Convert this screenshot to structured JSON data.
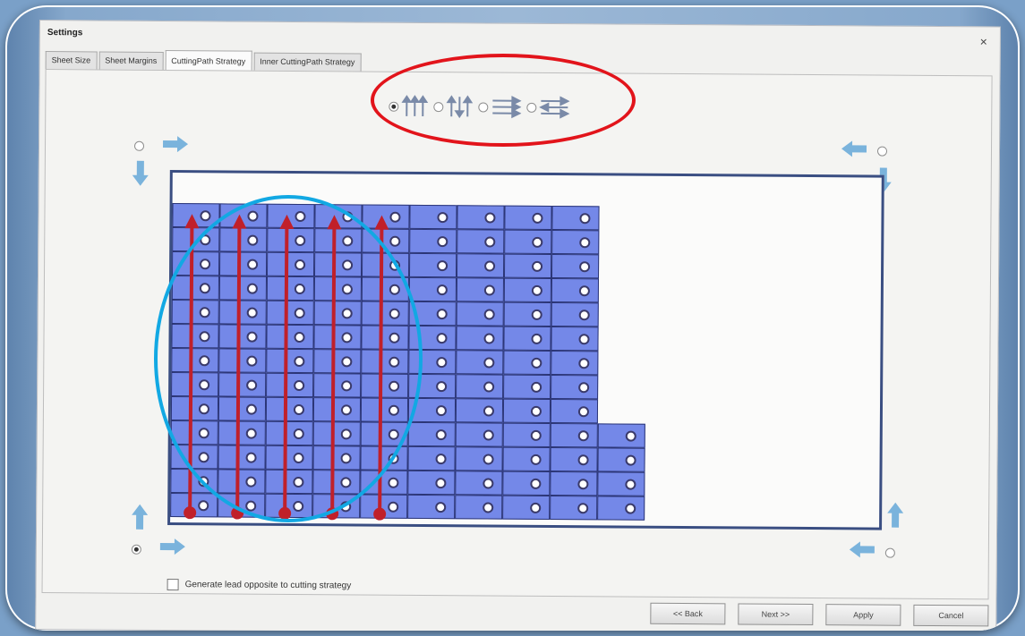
{
  "window": {
    "title": "Settings",
    "close_glyph": "×"
  },
  "tabs": [
    {
      "label": "Sheet Size",
      "active": false
    },
    {
      "label": "Sheet Margins",
      "active": false
    },
    {
      "label": "CuttingPath Strategy",
      "active": true
    },
    {
      "label": "Inner CuttingPath Strategy",
      "active": false
    }
  ],
  "strategy_options": [
    {
      "icon": "vertical-up-arrows-icon",
      "selected": true
    },
    {
      "icon": "vertical-alternating-arrows-icon",
      "selected": false
    },
    {
      "icon": "horizontal-right-arrows-icon",
      "selected": false
    },
    {
      "icon": "horizontal-alternating-arrows-icon",
      "selected": false
    }
  ],
  "start_corners": [
    {
      "corner": "top-left",
      "selected": false
    },
    {
      "corner": "top-right",
      "selected": false
    },
    {
      "corner": "bottom-left",
      "selected": true
    },
    {
      "corner": "bottom-right",
      "selected": false
    }
  ],
  "parts_grid": {
    "column_heights": [
      13,
      13,
      13,
      13,
      13,
      13,
      13,
      13,
      13,
      4
    ]
  },
  "cutting_path_arrows": {
    "count": 5,
    "direction": "up"
  },
  "options": {
    "generate_lead_label": "Generate lead opposite to cutting strategy",
    "generate_lead_checked": false
  },
  "buttons": {
    "back": "<< Back",
    "next": "Next >>",
    "apply": "Apply",
    "cancel": "Cancel"
  },
  "colors": {
    "part_fill": "#7488e8",
    "cut_path": "#c0202a",
    "arrow_fill": "#7ab3dc",
    "annotation_red": "#e2141b",
    "annotation_blue": "#12a8e3",
    "sheet_border": "#3a4e82"
  }
}
